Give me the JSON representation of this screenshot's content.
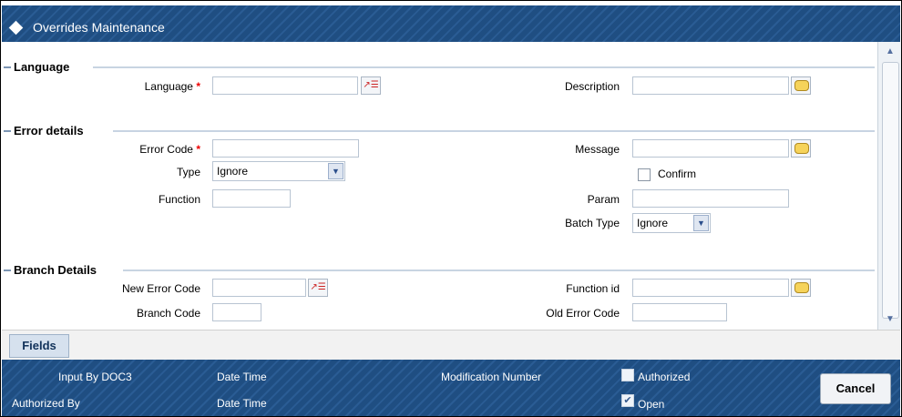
{
  "window": {
    "title": "Overrides Maintenance"
  },
  "language_section": {
    "title": "Language",
    "language_label": "Language",
    "language_value": "",
    "description_label": "Description",
    "description_value": ""
  },
  "error_section": {
    "title": "Error details",
    "error_code_label": "Error Code",
    "error_code_value": "",
    "type_label": "Type",
    "type_value": "Ignore",
    "function_label": "Function",
    "function_value": "",
    "message_label": "Message",
    "message_value": "",
    "confirm_label": "Confirm",
    "confirm_checked": false,
    "param_label": "Param",
    "param_value": "",
    "batch_type_label": "Batch Type",
    "batch_type_value": "Ignore"
  },
  "branch_section": {
    "title": "Branch Details",
    "new_error_code_label": "New Error Code",
    "new_error_code_value": "",
    "branch_code_label": "Branch Code",
    "branch_code_value": "",
    "function_id_label": "Function id",
    "function_id_value": "",
    "old_error_code_label": "Old Error Code",
    "old_error_code_value": ""
  },
  "required_marker": "*",
  "fields_tab": "Fields",
  "footer": {
    "input_by": "Input By DOC3",
    "date_time_1": "Date Time",
    "modification_number": "Modification Number",
    "authorized_label": "Authorized",
    "authorized_checked": false,
    "authorized_by": "Authorized By",
    "date_time_2": "Date Time",
    "open_label": "Open",
    "open_checked": true,
    "cancel": "Cancel"
  },
  "colors": {
    "title_bg": "#1f4e82",
    "required": "#ee0000",
    "section_line": "#c8d4e2"
  }
}
